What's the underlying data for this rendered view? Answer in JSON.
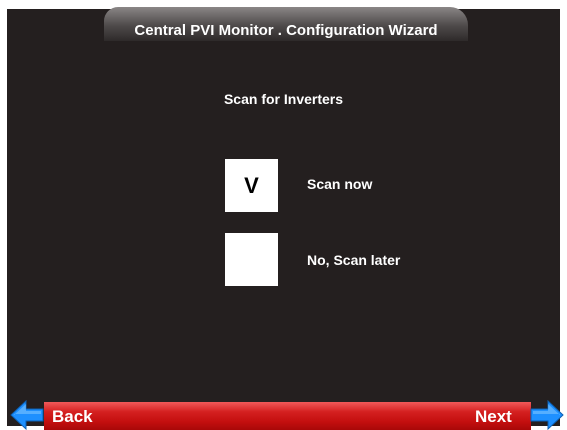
{
  "window": {
    "title": "Central PVI Monitor . Configuration Wizard"
  },
  "main": {
    "heading": "Scan for Inverters",
    "options": [
      {
        "mark": "V",
        "label": "Scan now",
        "selected": true
      },
      {
        "mark": "",
        "label": "No, Scan later",
        "selected": false
      }
    ]
  },
  "navigation": {
    "back_label": "Back",
    "next_label": "Next",
    "back_icon": "arrow-left-icon",
    "next_icon": "arrow-right-icon"
  },
  "colors": {
    "panel_background": "#241f1f",
    "nav_bar": "#d42020",
    "arrow": "#1e90ff"
  }
}
